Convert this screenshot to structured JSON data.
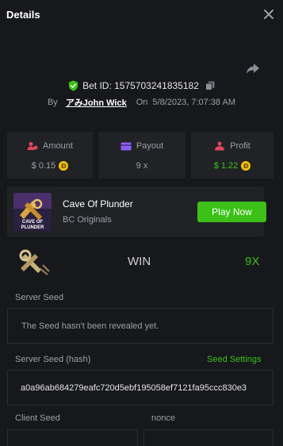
{
  "header": {
    "title": "Details"
  },
  "bet": {
    "id_text": "Bet ID: 1575703241835182"
  },
  "byline": {
    "by": "By",
    "user": "アみJohn Wick",
    "on": "On",
    "datetime": "5/8/2023, 7:07:38 AM"
  },
  "stats": [
    {
      "label": "Amount",
      "value": "$ 0.15",
      "icon": "user-coins-icon"
    },
    {
      "label": "Payout",
      "value": "9 x",
      "icon": "wallet-icon"
    },
    {
      "label": "Profit",
      "value": "$ 1.22",
      "icon": "profit-icon"
    }
  ],
  "game": {
    "name": "Cave Of Plunder",
    "provider": "BC Originals",
    "thumb_text": "CAVE OF PLUNDER",
    "play_label": "Play Now"
  },
  "result": {
    "outcome": "WIN",
    "multiplier": "9X"
  },
  "server_seed": {
    "label": "Server Seed",
    "value": "The Seed hasn't been revealed yet."
  },
  "server_seed_hash": {
    "label": "Server Seed (hash)",
    "settings_label": "Seed Settings",
    "value": "a0a96ab684279eafc720d5ebf195058ef7121fa95ccc830e3"
  },
  "client_seed": {
    "label": "Client Seed"
  },
  "nonce": {
    "label": "nonce"
  },
  "colors": {
    "accent": "#3bc117",
    "background": "#17181b",
    "panel": "#202226",
    "coin": "#f4c20d",
    "danger": "#e2465b",
    "purple": "#8b5cf6"
  }
}
